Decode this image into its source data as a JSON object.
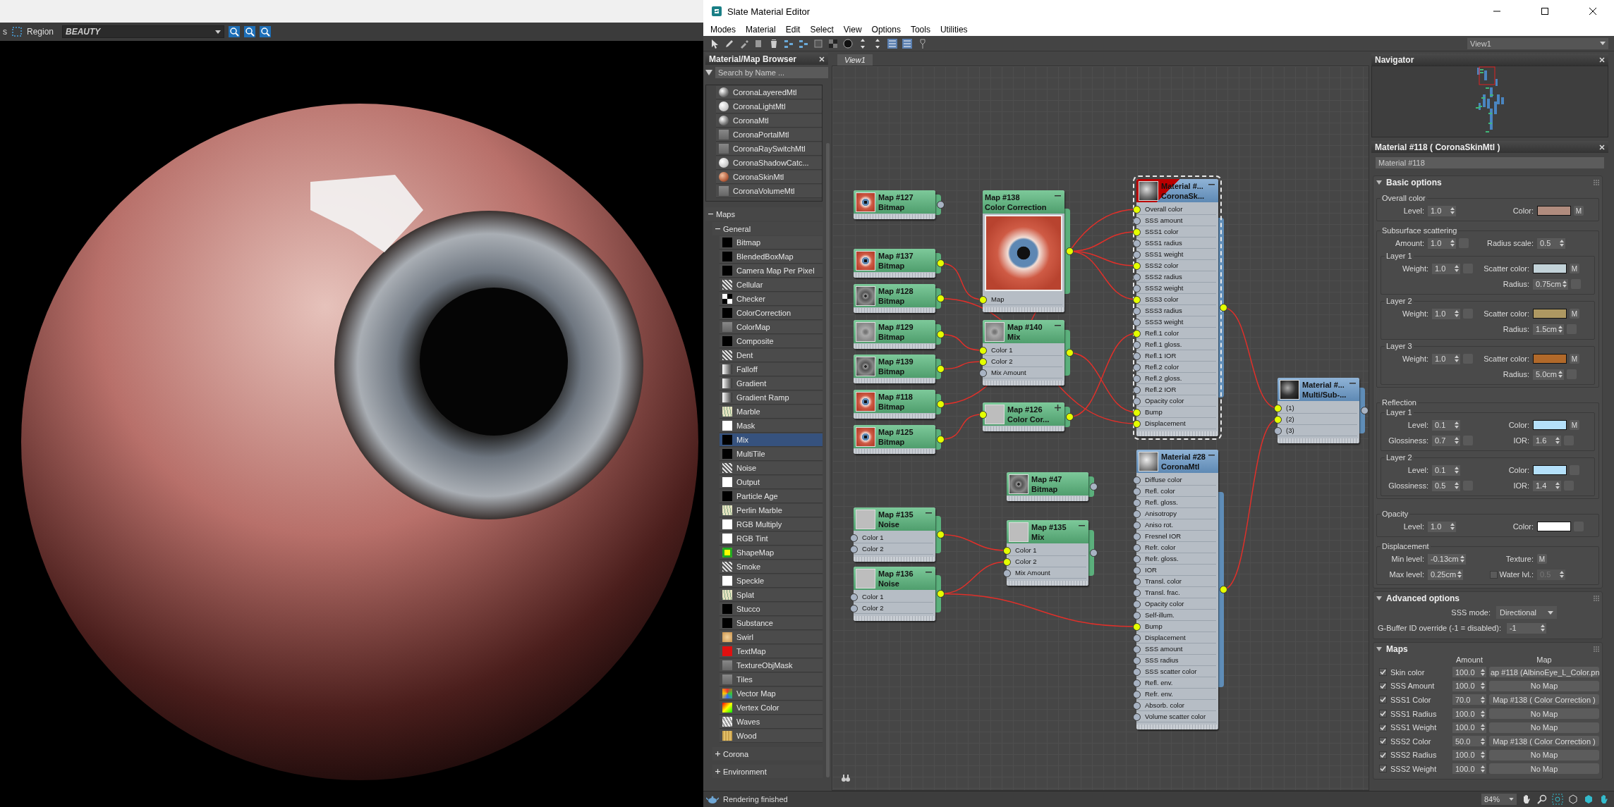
{
  "render_window": {
    "cut_label": "s",
    "region_label": "Region",
    "element": "BEAUTY"
  },
  "editor": {
    "title": "Slate Material Editor",
    "menu": [
      "Modes",
      "Material",
      "Edit",
      "Select",
      "View",
      "Options",
      "Tools",
      "Utilities"
    ],
    "view_select": "View1"
  },
  "browser": {
    "title": "Material/Map Browser",
    "search_placeholder": "Search by Name ...",
    "materials": [
      {
        "label": "CoronaLayeredMtl",
        "kind": "sphere",
        "selected": false
      },
      {
        "label": "CoronaLightMtl",
        "kind": "light",
        "selected": false
      },
      {
        "label": "CoronaMtl",
        "kind": "sphere",
        "selected": false
      },
      {
        "label": "CoronaPortalMtl",
        "kind": "grey",
        "selected": false
      },
      {
        "label": "CoronaRaySwitchMtl",
        "kind": "grey",
        "selected": false
      },
      {
        "label": "CoronaShadowCatc...",
        "kind": "light",
        "selected": false
      },
      {
        "label": "CoronaSkinMtl",
        "kind": "skin",
        "selected": false
      },
      {
        "label": "CoronaVolumeMtl",
        "kind": "grey",
        "selected": false
      }
    ],
    "maps": {
      "label": "Maps",
      "expanded": true
    },
    "general": {
      "label": "General",
      "expanded": true,
      "items": [
        {
          "label": "Bitmap",
          "kind": "black",
          "selected": false
        },
        {
          "label": "BlendedBoxMap",
          "kind": "black",
          "selected": false
        },
        {
          "label": "Camera Map Per Pixel",
          "kind": "black",
          "selected": false
        },
        {
          "label": "Cellular",
          "kind": "noise",
          "selected": false
        },
        {
          "label": "Checker",
          "kind": "checker",
          "selected": false
        },
        {
          "label": "ColorCorrection",
          "kind": "black",
          "selected": false
        },
        {
          "label": "ColorMap",
          "kind": "grey",
          "selected": false
        },
        {
          "label": "Composite",
          "kind": "black",
          "selected": false
        },
        {
          "label": "Dent",
          "kind": "noise",
          "selected": false
        },
        {
          "label": "Falloff",
          "kind": "gradient",
          "selected": false
        },
        {
          "label": "Gradient",
          "kind": "gradient",
          "selected": false
        },
        {
          "label": "Gradient Ramp",
          "kind": "gradient",
          "selected": false
        },
        {
          "label": "Marble",
          "kind": "marble",
          "selected": false
        },
        {
          "label": "Mask",
          "kind": "white",
          "selected": false
        },
        {
          "label": "Mix",
          "kind": "black",
          "selected": true
        },
        {
          "label": "MultiTile",
          "kind": "black",
          "selected": false
        },
        {
          "label": "Noise",
          "kind": "noise",
          "selected": false
        },
        {
          "label": "Output",
          "kind": "white",
          "selected": false
        },
        {
          "label": "Particle Age",
          "kind": "black",
          "selected": false
        },
        {
          "label": "Perlin Marble",
          "kind": "marble",
          "selected": false
        },
        {
          "label": "RGB Multiply",
          "kind": "white",
          "selected": false
        },
        {
          "label": "RGB Tint",
          "kind": "white",
          "selected": false
        },
        {
          "label": "ShapeMap",
          "kind": "shape",
          "selected": false
        },
        {
          "label": "Smoke",
          "kind": "noise",
          "selected": false
        },
        {
          "label": "Speckle",
          "kind": "white",
          "selected": false
        },
        {
          "label": "Splat",
          "kind": "marble",
          "selected": false
        },
        {
          "label": "Stucco",
          "kind": "black",
          "selected": false
        },
        {
          "label": "Substance",
          "kind": "black",
          "selected": false
        },
        {
          "label": "Swirl",
          "kind": "swirl",
          "selected": false
        },
        {
          "label": "TextMap",
          "kind": "text",
          "selected": false
        },
        {
          "label": "TextureObjMask",
          "kind": "grey",
          "selected": false
        },
        {
          "label": "Tiles",
          "kind": "grey",
          "selected": false
        },
        {
          "label": "Vector Map",
          "kind": "vector",
          "selected": false
        },
        {
          "label": "Vertex Color",
          "kind": "vertex",
          "selected": false
        },
        {
          "label": "Waves",
          "kind": "waves",
          "selected": false
        },
        {
          "label": "Wood",
          "kind": "wood",
          "selected": false
        }
      ]
    },
    "groups": [
      {
        "label": "Corona",
        "expanded": false
      },
      {
        "label": "Environment",
        "expanded": false
      }
    ]
  },
  "view": {
    "tab": "View1",
    "nodes": [
      {
        "title": "Map #127",
        "subtitle": "Bitmap",
        "kind": "map",
        "large_preview": false,
        "selected": false,
        "output_connected": false
      },
      {
        "title": "Map #138",
        "subtitle": "Color Correction",
        "kind": "map",
        "large_preview": true,
        "expanded": true,
        "selected": false,
        "sockets": [
          {
            "label": "Map",
            "connected": true
          }
        ],
        "output_connected": true
      },
      {
        "title": "Map #137",
        "subtitle": "Bitmap",
        "kind": "map",
        "large_preview": false,
        "selected": false,
        "output_connected": true
      },
      {
        "title": "Map #128",
        "subtitle": "Bitmap",
        "kind": "map",
        "large_preview": false,
        "selected": false,
        "output_connected": true
      },
      {
        "title": "Map #129",
        "subtitle": "Bitmap",
        "kind": "map",
        "large_preview": false,
        "selected": false,
        "output_connected": true
      },
      {
        "title": "Map #139",
        "subtitle": "Bitmap",
        "kind": "map",
        "large_preview": false,
        "selected": false,
        "output_connected": true
      },
      {
        "title": "Map #140",
        "subtitle": "Mix",
        "kind": "map",
        "large_preview": false,
        "expanded": true,
        "selected": false,
        "sockets": [
          {
            "label": "Color 1",
            "connected": true
          },
          {
            "label": "Color 2",
            "connected": true
          },
          {
            "label": "Mix Amount",
            "connected": false
          }
        ],
        "output_connected": true
      },
      {
        "title": "Map #118",
        "subtitle": "Bitmap",
        "kind": "map",
        "large_preview": false,
        "selected": false,
        "output_connected": true
      },
      {
        "title": "Map #125",
        "subtitle": "Bitmap",
        "kind": "map",
        "large_preview": false,
        "selected": false,
        "output_connected": true
      },
      {
        "title": "Map #126",
        "subtitle": "Color Cor...",
        "kind": "map",
        "large_preview": false,
        "expanded": false,
        "selected": false,
        "header_input_connected": true,
        "output_connected": true
      },
      {
        "title": "Map #47",
        "subtitle": "Bitmap",
        "kind": "map",
        "large_preview": false,
        "selected": false,
        "output_connected": false
      },
      {
        "title": "Map #135",
        "subtitle": "Noise",
        "kind": "map",
        "large_preview": false,
        "expanded": true,
        "selected": false,
        "sockets": [
          {
            "label": "Color 1",
            "connected": false
          },
          {
            "label": "Color 2",
            "connected": false
          }
        ],
        "output_connected": true
      },
      {
        "title": "Map #136",
        "subtitle": "Noise",
        "kind": "map",
        "large_preview": false,
        "expanded": true,
        "selected": false,
        "sockets": [
          {
            "label": "Color 1",
            "connected": false
          },
          {
            "label": "Color 2",
            "connected": false
          }
        ],
        "output_connected": true
      },
      {
        "title": "Map #135",
        "subtitle": "Mix",
        "kind": "map",
        "large_preview": false,
        "expanded": true,
        "selected": false,
        "sockets": [
          {
            "label": "Color 1",
            "connected": true
          },
          {
            "label": "Color 2",
            "connected": true
          },
          {
            "label": "Mix Amount",
            "connected": false
          }
        ],
        "output_connected": false
      },
      {
        "title": "Material #...",
        "subtitle": "CoronaSk...",
        "kind": "material",
        "large_preview": false,
        "expanded": true,
        "selected": true,
        "sockets": [
          {
            "label": "Overall color",
            "connected": true
          },
          {
            "label": "SSS amount",
            "connected": false
          },
          {
            "label": "SSS1 color",
            "connected": true
          },
          {
            "label": "SSS1 radius",
            "connected": false
          },
          {
            "label": "SSS1 weight",
            "connected": false
          },
          {
            "label": "SSS2 color",
            "connected": true
          },
          {
            "label": "SSS2 radius",
            "connected": false
          },
          {
            "label": "SSS2 weight",
            "connected": false
          },
          {
            "label": "SSS3 color",
            "connected": true
          },
          {
            "label": "SSS3 radius",
            "connected": false
          },
          {
            "label": "SSS3 weight",
            "connected": false
          },
          {
            "label": "Refl.1 color",
            "connected": true
          },
          {
            "label": "Refl.1 gloss.",
            "connected": false
          },
          {
            "label": "Refl.1 IOR",
            "connected": false
          },
          {
            "label": "Refl.2 color",
            "connected": false
          },
          {
            "label": "Refl.2 gloss.",
            "connected": false
          },
          {
            "label": "Refl.2 IOR",
            "connected": false
          },
          {
            "label": "Opacity color",
            "connected": false
          },
          {
            "label": "Bump",
            "connected": true
          },
          {
            "label": "Displacement",
            "connected": true
          }
        ],
        "output_connected": true
      },
      {
        "title": "Material #28",
        "subtitle": "CoronaMtl",
        "kind": "material",
        "large_preview": false,
        "expanded": true,
        "selected": false,
        "sockets": [
          {
            "label": "Diffuse color",
            "connected": false
          },
          {
            "label": "Refl. color",
            "connected": false
          },
          {
            "label": "Refl. gloss.",
            "connected": false
          },
          {
            "label": "Anisotropy",
            "connected": false
          },
          {
            "label": "Aniso rot.",
            "connected": false
          },
          {
            "label": "Fresnel IOR",
            "connected": false
          },
          {
            "label": "Refr. color",
            "connected": false
          },
          {
            "label": "Refr. gloss.",
            "connected": false
          },
          {
            "label": "IOR",
            "connected": false
          },
          {
            "label": "Transl. color",
            "connected": false
          },
          {
            "label": "Transl. frac.",
            "connected": false
          },
          {
            "label": "Opacity color",
            "connected": false
          },
          {
            "label": "Self-illum.",
            "connected": false
          },
          {
            "label": "Bump",
            "connected": true
          },
          {
            "label": "Displacement",
            "connected": false
          },
          {
            "label": "SSS amount",
            "connected": false
          },
          {
            "label": "SSS radius",
            "connected": false
          },
          {
            "label": "SSS scatter color",
            "connected": false
          },
          {
            "label": "Refl. env.",
            "connected": false
          },
          {
            "label": "Refr. env.",
            "connected": false
          },
          {
            "label": "Absorb. color",
            "connected": false
          },
          {
            "label": "Volume scatter color",
            "connected": false
          }
        ],
        "output_connected": true
      },
      {
        "title": "Material #...",
        "subtitle": "Multi/Sub-...",
        "kind": "material",
        "large_preview": false,
        "expanded": true,
        "selected": false,
        "sockets": [
          {
            "label": "(1)",
            "connected": true
          },
          {
            "label": "(2)",
            "connected": true
          },
          {
            "label": "(3)",
            "connected": false
          }
        ],
        "output_connected": false
      }
    ]
  },
  "navigator": {
    "title": "Navigator"
  },
  "params": {
    "title": "Material #118  ( CoronaSkinMtl )",
    "name": "Material #118",
    "basic": {
      "title": "Basic options",
      "expanded": true,
      "groups": [
        {
          "title": "Overall color",
          "rows": [
            {
              "left": {
                "kind": "spinner",
                "label": "Level:",
                "value": "1.0"
              },
              "right": {
                "kind": "color",
                "label": "Color:",
                "color": "#b08c7e",
                "map": "M"
              }
            }
          ]
        },
        {
          "title": "Subsurface scattering",
          "rows": [
            {
              "left": {
                "kind": "spinner",
                "label": "Amount:",
                "value": "1.0",
                "slot": true
              },
              "right": {
                "kind": "spinner",
                "label": "Radius scale:",
                "value": "0.5"
              }
            }
          ],
          "layers": [
            {
              "title": "Layer 1",
              "rows": [
                {
                  "left": {
                    "kind": "spinner",
                    "label": "Weight:",
                    "value": "1.0",
                    "slot": true
                  },
                  "right": {
                    "kind": "color",
                    "label": "Scatter color:",
                    "color": "#c3d3d9",
                    "map": "M"
                  }
                },
                {
                  "right": {
                    "kind": "spinner",
                    "label": "Radius:",
                    "value": "0.75cm",
                    "slot": true
                  }
                }
              ]
            },
            {
              "title": "Layer 2",
              "rows": [
                {
                  "left": {
                    "kind": "spinner",
                    "label": "Weight:",
                    "value": "1.0",
                    "slot": true
                  },
                  "right": {
                    "kind": "color",
                    "label": "Scatter color:",
                    "color": "#ae9862",
                    "map": "M"
                  }
                },
                {
                  "right": {
                    "kind": "spinner",
                    "label": "Radius:",
                    "value": "1.5cm",
                    "slot": true
                  }
                }
              ]
            },
            {
              "title": "Layer 3",
              "rows": [
                {
                  "left": {
                    "kind": "spinner",
                    "label": "Weight:",
                    "value": "1.0",
                    "slot": true
                  },
                  "right": {
                    "kind": "color",
                    "label": "Scatter color:",
                    "color": "#b1692a",
                    "map": "M"
                  }
                },
                {
                  "right": {
                    "kind": "spinner",
                    "label": "Radius:",
                    "value": "5.0cm",
                    "slot": true
                  }
                }
              ]
            }
          ]
        },
        {
          "title": "Reflection",
          "layers": [
            {
              "title": "Layer 1",
              "rows": [
                {
                  "left": {
                    "kind": "spinner",
                    "label": "Level:",
                    "value": "0.1"
                  },
                  "right": {
                    "kind": "color",
                    "label": "Color:",
                    "color": "#b4e0fa",
                    "map": "M"
                  }
                },
                {
                  "left": {
                    "kind": "spinner",
                    "label": "Glossiness:",
                    "value": "0.7",
                    "slot": true
                  },
                  "right": {
                    "kind": "spinner",
                    "label": "IOR:",
                    "value": "1.6",
                    "slot": true
                  }
                }
              ]
            },
            {
              "title": "Layer 2",
              "rows": [
                {
                  "left": {
                    "kind": "spinner",
                    "label": "Level:",
                    "value": "0.1"
                  },
                  "right": {
                    "kind": "color",
                    "label": "Color:",
                    "color": "#b4e0fa",
                    "slot": true
                  }
                },
                {
                  "left": {
                    "kind": "spinner",
                    "label": "Glossiness:",
                    "value": "0.5",
                    "slot": true
                  },
                  "right": {
                    "kind": "spinner",
                    "label": "IOR:",
                    "value": "1.4",
                    "slot": true
                  }
                }
              ]
            }
          ]
        },
        {
          "title": "Opacity",
          "rows": [
            {
              "left": {
                "kind": "spinner",
                "label": "Level:",
                "value": "1.0"
              },
              "right": {
                "kind": "color",
                "label": "Color:",
                "color": "#ffffff",
                "slot": true
              }
            }
          ]
        },
        {
          "title": "Displacement",
          "rows": [
            {
              "left": {
                "kind": "spinner",
                "label": "Min level:",
                "value": "-0.13cm"
              },
              "right": {
                "kind": "texture",
                "label": "Texture:",
                "map": "M"
              }
            },
            {
              "left": {
                "kind": "spinner",
                "label": "Max level:",
                "value": "0.25cm"
              },
              "right": {
                "kind": "check_spinner",
                "label": "Water lvl.:",
                "value": "0.5",
                "checked": false,
                "disabled": true
              }
            }
          ]
        }
      ]
    },
    "advanced": {
      "title": "Advanced options",
      "expanded": true,
      "sss_label": "SSS mode:",
      "sss_value": "Directional",
      "gbuffer_label": "G-Buffer ID override (-1 = disabled):",
      "gbuffer_value": "-1"
    },
    "maps": {
      "title": "Maps",
      "expanded": true,
      "amount_header": "Amount",
      "map_header": "Map",
      "rows": [
        {
          "label": "Skin color",
          "checked": true,
          "amount": "100.0",
          "map": "ap #118 (AlbinoEye_L_Color.pn"
        },
        {
          "label": "SSS Amount",
          "checked": true,
          "amount": "100.0",
          "map": "No Map"
        },
        {
          "label": "SSS1 Color",
          "checked": true,
          "amount": "70.0",
          "map": "Map #138  ( Color Correction )"
        },
        {
          "label": "SSS1 Radius",
          "checked": true,
          "amount": "100.0",
          "map": "No Map"
        },
        {
          "label": "SSS1 Weight",
          "checked": true,
          "amount": "100.0",
          "map": "No Map"
        },
        {
          "label": "SSS2 Color",
          "checked": true,
          "amount": "50.0",
          "map": "Map #138  ( Color Correction )"
        },
        {
          "label": "SSS2 Radius",
          "checked": true,
          "amount": "100.0",
          "map": "No Map"
        },
        {
          "label": "SSS2 Weight",
          "checked": true,
          "amount": "100.0",
          "map": "No Map"
        }
      ]
    }
  },
  "status": {
    "message": "Rendering finished",
    "zoom": "84%"
  }
}
